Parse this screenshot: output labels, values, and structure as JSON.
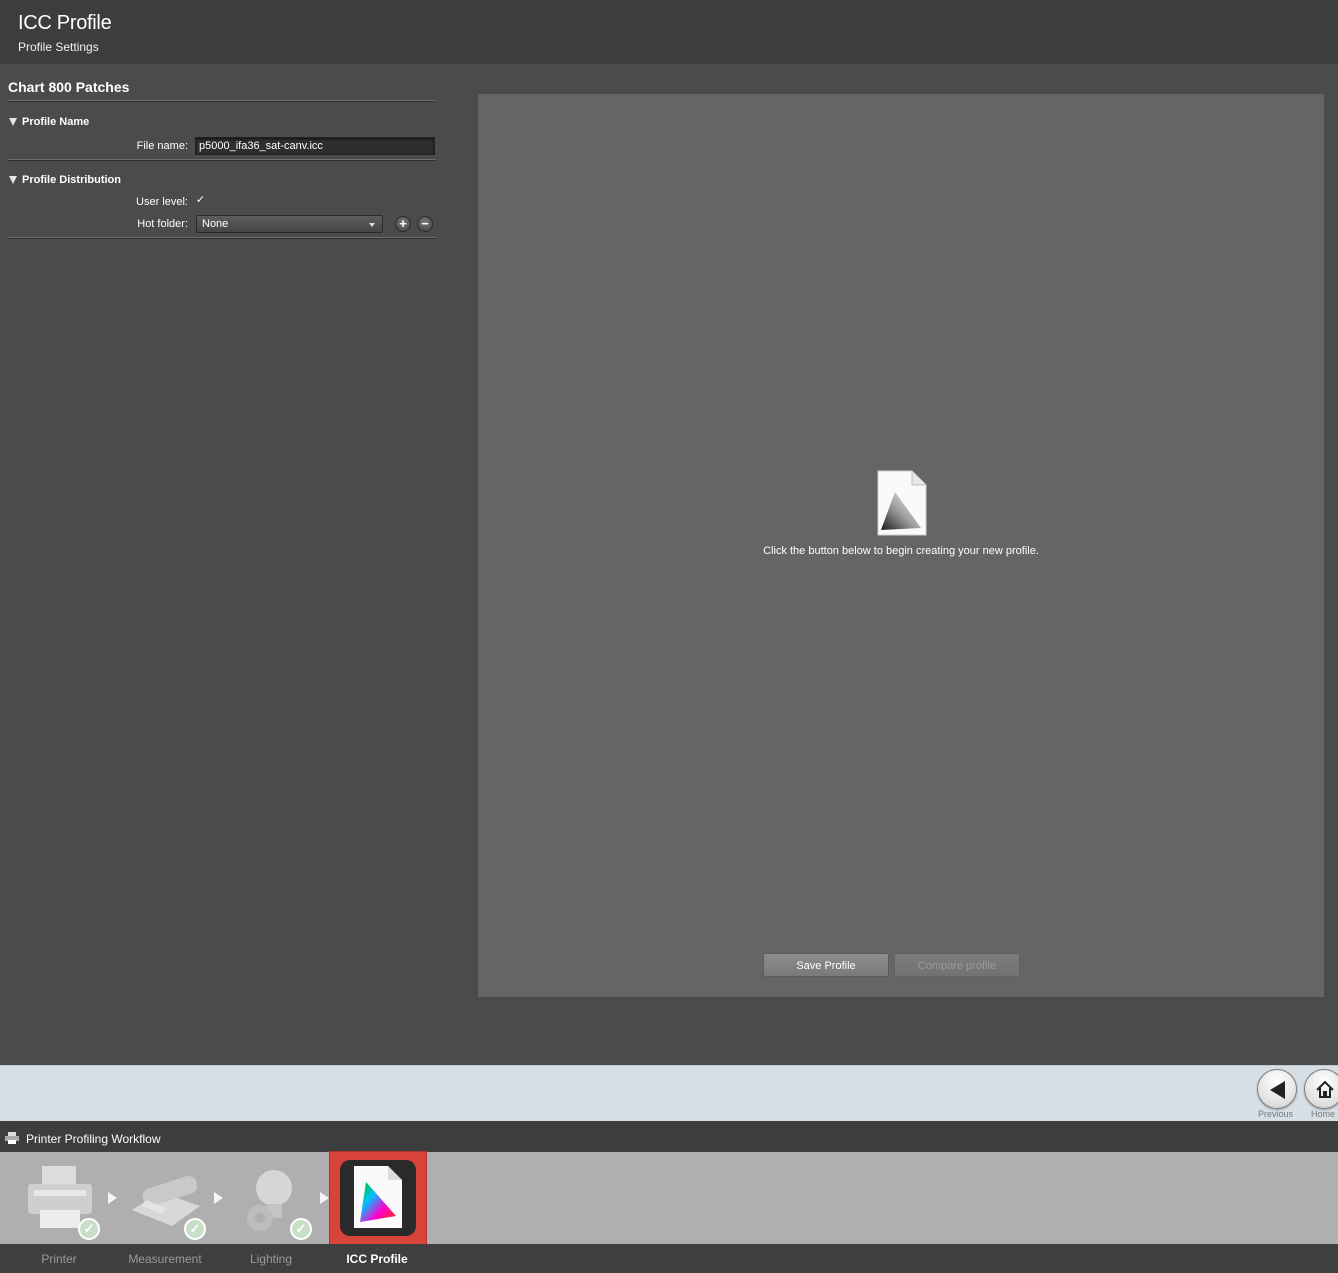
{
  "header": {
    "title": "ICC Profile",
    "subtitle": "Profile Settings"
  },
  "left": {
    "chart_title": "Chart 800 Patches",
    "profile_name": {
      "heading": "Profile Name",
      "file_name_label": "File name:",
      "file_name_value": "p5000_ifa36_sat-canv.icc"
    },
    "distribution": {
      "heading": "Profile Distribution",
      "user_level_label": "User level:",
      "user_level_checked": true,
      "checkmark": "✓",
      "hot_folder_label": "Hot folder:",
      "hot_folder_value": "None",
      "add_glyph": "+",
      "remove_glyph": "−"
    }
  },
  "main": {
    "message": "Click the button below to begin creating your new profile.",
    "save_label": "Save Profile",
    "compare_label": "Compare profile"
  },
  "nav": {
    "previous_label": "Previous",
    "home_label": "Home"
  },
  "workflow": {
    "title": "Printer Profiling Workflow",
    "steps": [
      {
        "label": "Printer",
        "done": true
      },
      {
        "label": "Measurement",
        "done": true
      },
      {
        "label": "Lighting",
        "done": true
      },
      {
        "label": "ICC Profile",
        "active": true
      }
    ],
    "check_glyph": "✓"
  },
  "colors": {
    "accent_active": "#d8433a",
    "panel": "#656565",
    "background": "#4b4b4b"
  }
}
